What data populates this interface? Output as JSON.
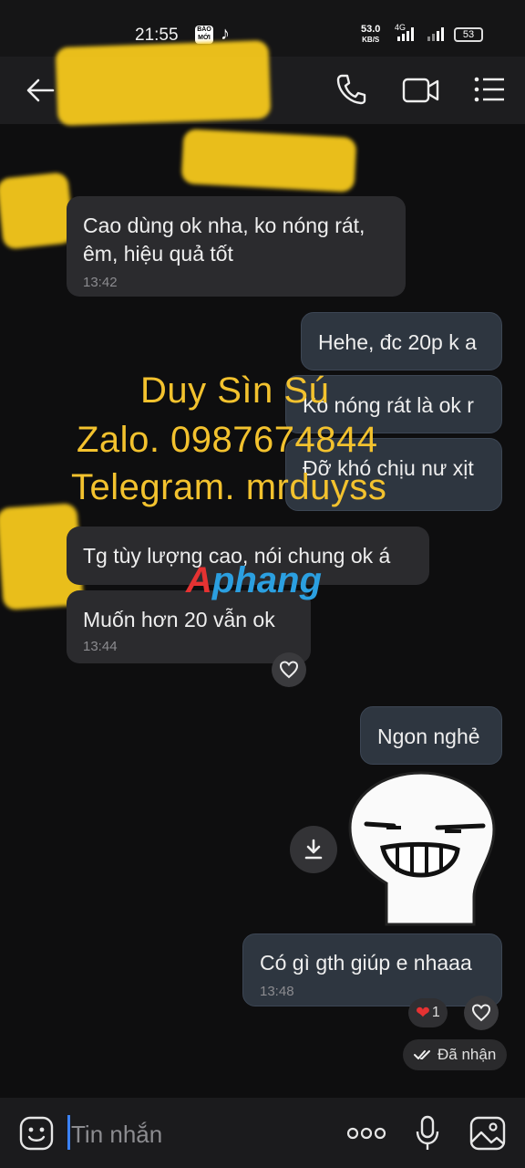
{
  "status_bar": {
    "time": "21:55",
    "baomoi_label": "BÁO MỚI",
    "net_speed": "53.0",
    "net_speed_unit": "KB/S",
    "network_type": "4G",
    "battery": "53"
  },
  "header": {
    "icons": [
      "back-arrow-icon",
      "phone-icon",
      "video-call-icon",
      "menu-list-icon"
    ]
  },
  "messages": [
    {
      "side": "incoming",
      "text_line1": "Cao dùng ok nha, ko nóng rát,",
      "text_line2": "êm, hiệu quả tốt",
      "time": "13:42"
    },
    {
      "side": "outgoing",
      "text": "Hehe, đc 20p k a"
    },
    {
      "side": "outgoing",
      "text": "Ko nóng rát là ok r"
    },
    {
      "side": "outgoing",
      "text": "Đỡ khó chịu nư xịt"
    },
    {
      "side": "incoming",
      "text": "Tg tùy lượng cao, nói chung ok á"
    },
    {
      "side": "incoming",
      "text": "Muốn hơn 20 vẫn ok",
      "time": "13:44"
    },
    {
      "side": "outgoing",
      "text": "Ngon nghẻ"
    },
    {
      "side": "outgoing",
      "text": "Có gì gth giúp e nhaaa",
      "time": "13:48",
      "reaction_count": "1"
    }
  ],
  "watermark": {
    "line1": "Duy Sìn Sú",
    "line2": "Zalo. 0987674844",
    "line3": "Telegram. mrduyss",
    "logo_a": "A",
    "logo_rest": "phang"
  },
  "received_status": "Đã nhận",
  "composer": {
    "placeholder": "Tin nhắn"
  },
  "colors": {
    "background": "#0e0e0f",
    "incoming_bubble": "#2b2b2e",
    "outgoing_bubble": "#2e3640",
    "watermark": "#f3c22e",
    "redaction": "#f5c81c"
  }
}
